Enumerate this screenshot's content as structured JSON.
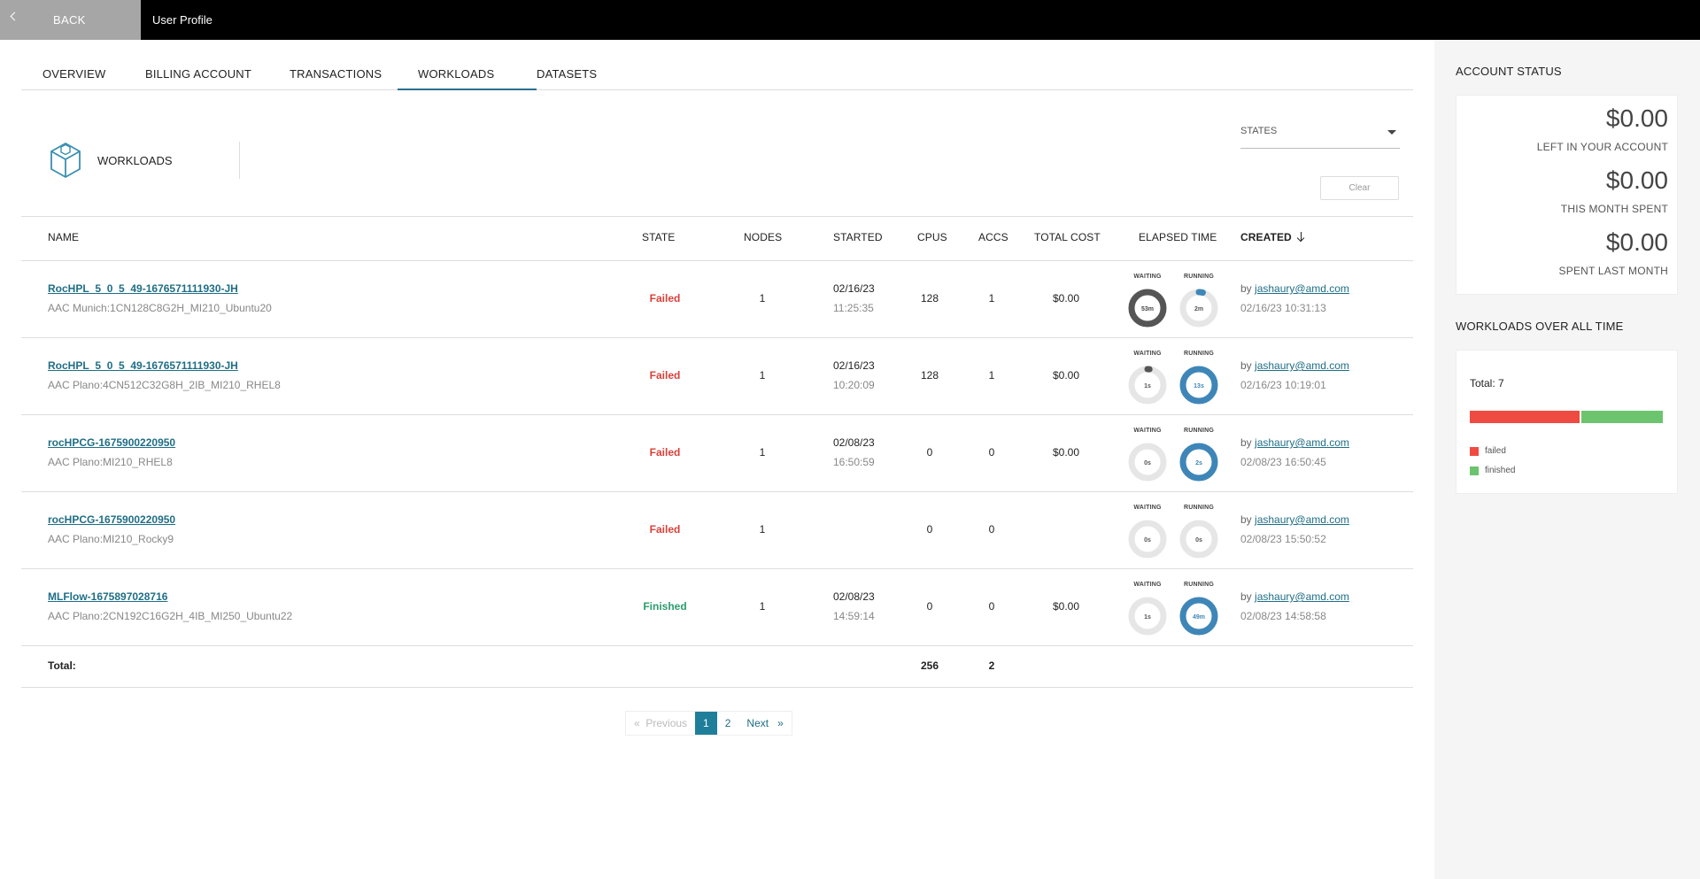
{
  "topbar": {
    "back_label": "BACK",
    "title": "User Profile"
  },
  "tabs": [
    "OVERVIEW",
    "BILLING ACCOUNT",
    "TRANSACTIONS",
    "WORKLOADS",
    "DATASETS"
  ],
  "active_tab": "WORKLOADS",
  "workloads_header": {
    "label": "WORKLOADS",
    "states_placeholder": "STATES",
    "clear_label": "Clear"
  },
  "table": {
    "headers": {
      "name": "NAME",
      "state": "STATE",
      "nodes": "NODES",
      "started": "STARTED",
      "cpus": "CPUS",
      "accs": "ACCS",
      "total_cost": "TOTAL COST",
      "elapsed_time": "ELAPSED TIME",
      "created": "CREATED"
    },
    "waiting_label": "WAITING",
    "running_label": "RUNNING",
    "by_label": "by",
    "rows": [
      {
        "name": "RocHPL_5_0_5_49-1676571111930-JH",
        "sub": "AAC Munich:1CN128C8G2H_MI210_Ubuntu20",
        "state": "Failed",
        "nodes": "1",
        "started_date": "02/16/23",
        "started_time": "11:25:35",
        "cpus": "128",
        "accs": "1",
        "cost": "$0.00",
        "waiting": "53m",
        "waiting_fill": 1.0,
        "running": "2m",
        "running_fill": 0.04,
        "created_by": "jashaury@amd.com",
        "created_at": "02/16/23 10:31:13"
      },
      {
        "name": "RocHPL_5_0_5_49-1676571111930-JH",
        "sub": "AAC Plano:4CN512C32G8H_2IB_MI210_RHEL8",
        "state": "Failed",
        "nodes": "1",
        "started_date": "02/16/23",
        "started_time": "10:20:09",
        "cpus": "128",
        "accs": "1",
        "cost": "$0.00",
        "waiting": "1s",
        "waiting_fill": 0.02,
        "running": "13s",
        "running_fill": 1.0,
        "created_by": "jashaury@amd.com",
        "created_at": "02/16/23 10:19:01"
      },
      {
        "name": "rocHPCG-1675900220950",
        "sub": "AAC Plano:MI210_RHEL8",
        "state": "Failed",
        "nodes": "1",
        "started_date": "02/08/23",
        "started_time": "16:50:59",
        "cpus": "0",
        "accs": "0",
        "cost": "$0.00",
        "waiting": "0s",
        "waiting_fill": 0,
        "running": "2s",
        "running_fill": 1.0,
        "created_by": "jashaury@amd.com",
        "created_at": "02/08/23 16:50:45"
      },
      {
        "name": "rocHPCG-1675900220950",
        "sub": "AAC Plano:MI210_Rocky9",
        "state": "Failed",
        "nodes": "1",
        "started_date": "",
        "started_time": "",
        "cpus": "0",
        "accs": "0",
        "cost": "",
        "waiting": "0s",
        "waiting_fill": 0,
        "running": "0s",
        "running_fill": 0,
        "created_by": "jashaury@amd.com",
        "created_at": "02/08/23 15:50:52"
      },
      {
        "name": "MLFlow-1675897028716",
        "sub": "AAC Plano:2CN192C16G2H_4IB_MI250_Ubuntu22",
        "state": "Finished",
        "nodes": "1",
        "started_date": "02/08/23",
        "started_time": "14:59:14",
        "cpus": "0",
        "accs": "0",
        "cost": "$0.00",
        "waiting": "1s",
        "waiting_fill": 0,
        "running": "49m",
        "running_fill": 1.0,
        "created_by": "jashaury@amd.com",
        "created_at": "02/08/23 14:58:58"
      }
    ],
    "totals": {
      "label": "Total:",
      "cpus": "256",
      "accs": "2"
    }
  },
  "pagination": {
    "previous": "Previous",
    "prev_arrow": "«",
    "pages": [
      "1",
      "2"
    ],
    "current": "1",
    "next": "Next",
    "next_arrow": "»"
  },
  "sidebar": {
    "account_status_title": "ACCOUNT STATUS",
    "amounts": [
      {
        "value": "$0.00",
        "label": "LEFT IN YOUR ACCOUNT"
      },
      {
        "value": "$0.00",
        "label": "THIS MONTH SPENT"
      },
      {
        "value": "$0.00",
        "label": "SPENT LAST MONTH"
      }
    ],
    "workloads_title": "WORKLOADS OVER ALL TIME",
    "total": "Total: 7",
    "breakdown": [
      {
        "label": "failed",
        "fraction": 0.57,
        "color": "#ef4b43"
      },
      {
        "label": "finished",
        "fraction": 0.43,
        "color": "#6cc46e"
      }
    ]
  },
  "colors": {
    "accent": "#1f7f9a",
    "failed": "#d9403a",
    "finished": "#2a9d6e",
    "waiting_ring": "#555555",
    "running_ring": "#3e86b8",
    "track": "#e6e6e6"
  }
}
